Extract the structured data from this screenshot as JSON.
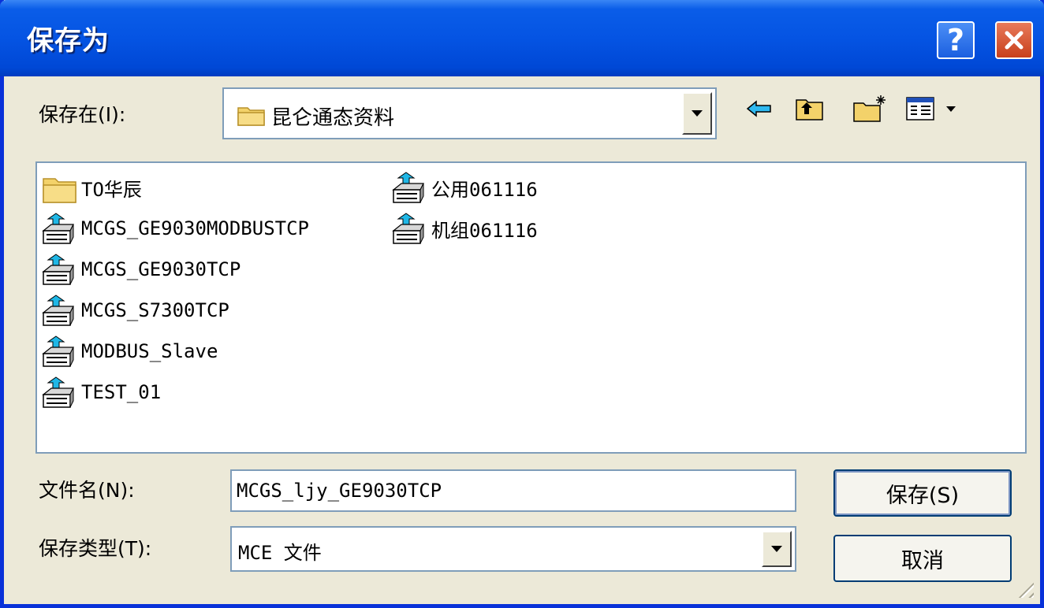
{
  "window": {
    "title": "保存为"
  },
  "title_buttons": {
    "help": "?"
  },
  "save_in": {
    "label": "保存在(I):",
    "value": "昆仑通态资料"
  },
  "toolbar": {
    "icons": [
      "back-arrow-icon",
      "up-folder-icon",
      "new-folder-icon",
      "view-menu-icon"
    ]
  },
  "files": [
    {
      "name": "TO华辰",
      "type": "folder"
    },
    {
      "name": "MCGS_GE9030MODBUSTCP",
      "type": "project"
    },
    {
      "name": "MCGS_GE9030TCP",
      "type": "project"
    },
    {
      "name": "MCGS_S7300TCP",
      "type": "project"
    },
    {
      "name": "MODBUS_Slave",
      "type": "project"
    },
    {
      "name": "TEST_01",
      "type": "project"
    },
    {
      "name": "公用061116",
      "type": "project"
    },
    {
      "name": "机组061116",
      "type": "project"
    }
  ],
  "filename": {
    "label": "文件名(N):",
    "value": "MCGS_ljy_GE9030TCP"
  },
  "filetype": {
    "label": "保存类型(T):",
    "value": "MCE 文件"
  },
  "buttons": {
    "save": "保存(S)",
    "cancel": "取消"
  },
  "colors": {
    "title_bar": "#0554e3",
    "window_border": "#0831d9",
    "face": "#ece9d8",
    "field_border": "#7f9db9",
    "close_button": "#c8401c"
  }
}
